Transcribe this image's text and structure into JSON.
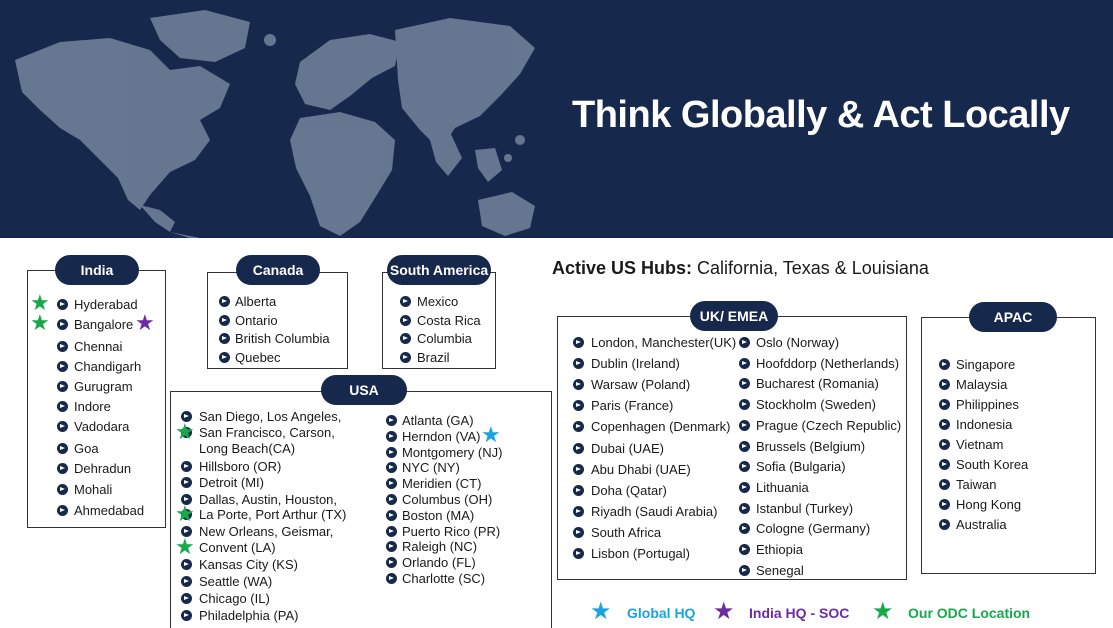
{
  "banner": {
    "title": "Think Globally & Act Locally"
  },
  "active_hubs": {
    "label": "Active US Hubs:",
    "value": "California, Texas & Louisiana"
  },
  "regions": {
    "india": {
      "title": "India",
      "items": [
        "Hyderabad",
        "Bangalore",
        "Chennai",
        "Chandigarh",
        "Gurugram",
        "Indore",
        "Vadodara",
        "Goa",
        "Dehradun",
        "Mohali",
        "Ahmedabad"
      ]
    },
    "canada": {
      "title": "Canada",
      "items": [
        "Alberta",
        "Ontario",
        "British Columbia",
        "Quebec"
      ]
    },
    "south_america": {
      "title": "South America",
      "items": [
        "Mexico",
        "Costa Rica",
        "Columbia",
        "Brazil"
      ]
    },
    "usa": {
      "title": "USA",
      "left": [
        "San Diego, Los Angeles,",
        "San Francisco, Carson,",
        "Long Beach(CA)",
        "Hillsboro (OR)",
        "Detroit (MI)",
        "Dallas, Austin, Houston,",
        "La Porte, Port Arthur (TX)",
        "New Orleans, Geismar,",
        "Convent (LA)",
        "Kansas City (KS)",
        "Seattle (WA)",
        "Chicago (IL)",
        "Philadelphia (PA)"
      ],
      "right": [
        "Atlanta (GA)",
        "Herndon (VA)",
        "Montgomery (NJ)",
        "NYC (NY)",
        "Meridien (CT)",
        "Columbus (OH)",
        "Boston (MA)",
        "Puerto Rico (PR)",
        "Raleigh (NC)",
        "Orlando (FL)",
        "Charlotte (SC)"
      ]
    },
    "uk_emea": {
      "title": "UK/ EMEA",
      "left": [
        "London, Manchester(UK)",
        "Dublin (Ireland)",
        "Warsaw (Poland)",
        "Paris (France)",
        "Copenhagen (Denmark)",
        "Dubai (UAE)",
        "Abu Dhabi (UAE)",
        "Doha (Qatar)",
        "Riyadh (Saudi Arabia)",
        "South Africa",
        "Lisbon (Portugal)"
      ],
      "right": [
        "Oslo (Norway)",
        "Hoofddorp (Netherlands)",
        "Bucharest (Romania)",
        "Stockholm (Sweden)",
        "Prague (Czech Republic)",
        "Brussels (Belgium)",
        "Sofia (Bulgaria)",
        "Lithuania",
        "Istanbul (Turkey)",
        "Cologne (Germany)",
        "Ethiopia",
        "Senegal"
      ]
    },
    "apac": {
      "title": "APAC",
      "items": [
        "Singapore",
        "Malaysia",
        "Philippines",
        "Indonesia",
        "Vietnam",
        "South Korea",
        "Taiwan",
        "Hong Kong",
        "Australia"
      ]
    }
  },
  "legend": {
    "global_hq": "Global HQ",
    "india_hq": "India HQ - SOC",
    "odc": "Our ODC Location"
  },
  "icons": {
    "bullet": "arrow-circle-icon",
    "star": "star-icon"
  },
  "colors": {
    "navy": "#17284d",
    "global_hq": "#1aa3df",
    "india_hq": "#6b2ca0",
    "odc": "#17a84a"
  }
}
